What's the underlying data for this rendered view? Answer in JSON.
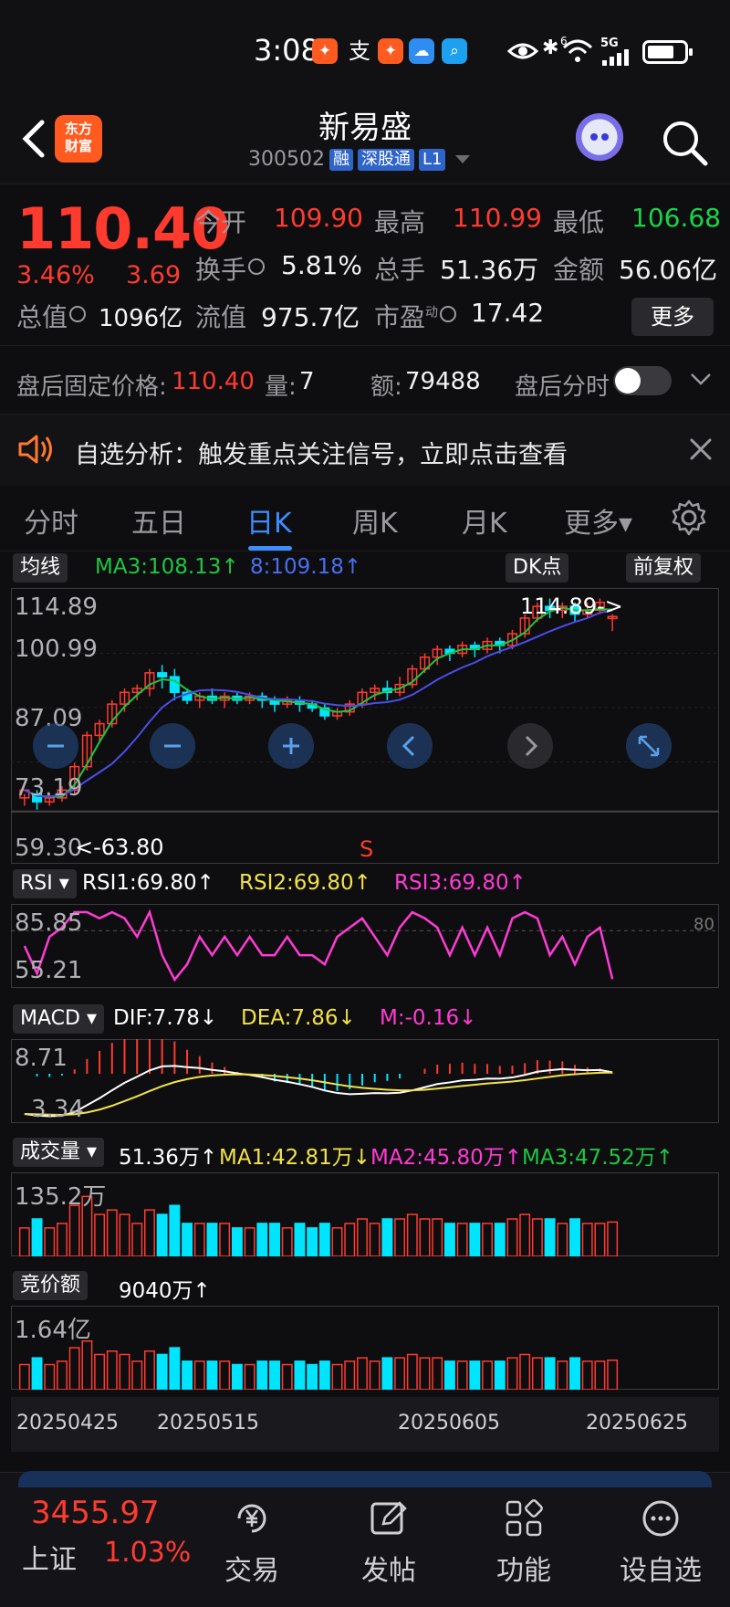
{
  "status_bar": {
    "time": "3:08",
    "apps": [
      "支"
    ],
    "network": "5G",
    "wifi_badge": "6"
  },
  "header": {
    "logo_text": "东方\n财富",
    "stock_name": "新易盛",
    "stock_code": "300502",
    "tags": [
      "融",
      "深股通",
      "L1"
    ]
  },
  "quote": {
    "price": "110.40",
    "change_pct": "3.46%",
    "change_amt": "3.69",
    "open_label": "今开",
    "open": "109.90",
    "high_label": "最高",
    "high": "110.99",
    "low_label": "最低",
    "low": "106.68",
    "turnover_label": "换手",
    "turnover": "5.81%",
    "volume_label": "总手",
    "volume": "51.36万",
    "amount_label": "金额",
    "amount": "56.06亿",
    "mktcap_label": "总值",
    "mktcap": "1096亿",
    "float_label": "流值",
    "float": "975.7亿",
    "pe_label": "市盈",
    "pe_super": "动",
    "pe": "17.42",
    "more_label": "更多"
  },
  "after_hours": {
    "price_label": "盘后固定价格:",
    "price": "110.40",
    "vol_label": "量:",
    "vol": "7",
    "amt_label": "额:",
    "amt": "79488",
    "timeshare_label": "盘后分时",
    "toggle_on": false
  },
  "notice": {
    "text": "自选分析：触发重点关注信号，立即点击查看"
  },
  "tabs": [
    {
      "label": "分时"
    },
    {
      "label": "五日"
    },
    {
      "label": "日K",
      "active": true
    },
    {
      "label": "周K"
    },
    {
      "label": "月K"
    },
    {
      "label": "更多▾"
    }
  ],
  "kline": {
    "ma_button": "均线",
    "ma3": "MA3:108.13↑",
    "ma8": "8:109.18↑",
    "dk_button": "DK点",
    "adjust_button": "前复权",
    "y_labels": [
      "114.89",
      "100.99",
      "87.09",
      "73.19",
      "59.30"
    ],
    "high_marker": "114.89->",
    "low_marker": "<-63.80",
    "s_mark": "S",
    "colors": {
      "up": "#ff3b30",
      "down": "#00e5ff",
      "ma3": "#1fc640",
      "ma8": "#4a4ee8"
    }
  },
  "rsi": {
    "button": "RSI",
    "rsi1": "RSI1:69.80↑",
    "rsi2": "RSI2:69.80↑",
    "rsi3": "RSI3:69.80↑",
    "y_labels": [
      "85.85",
      "55.21"
    ],
    "ref_line": "80"
  },
  "macd": {
    "button": "MACD",
    "dif": "DIF:7.78↓",
    "dea": "DEA:7.86↓",
    "m": "M:-0.16↓",
    "y_labels": [
      "8.71",
      "3.34"
    ]
  },
  "volume": {
    "button": "成交量",
    "value": "51.36万↑",
    "ma1": "MA1:42.81万↓",
    "ma2": "MA2:45.80万↑",
    "ma3": "MA3:47.52万↑",
    "y_label": "135.2万"
  },
  "auction": {
    "button": "竞价额",
    "value": "9040万↑",
    "y_label": "1.64亿"
  },
  "dates": [
    "20250425",
    "20250515",
    "20250605",
    "20250625"
  ],
  "chart_data": {
    "type": "candlestick",
    "y_axis_ticks": [
      59.3,
      73.19,
      87.09,
      100.99,
      114.89
    ],
    "period_high": 114.89,
    "period_low": 63.8,
    "last": {
      "open": 109.9,
      "high": 110.99,
      "low": 106.68,
      "close": 110.4
    },
    "candles": [
      [
        64,
        66,
        62,
        65
      ],
      [
        65,
        63,
        61,
        66
      ],
      [
        63,
        64,
        62,
        65
      ],
      [
        64,
        66,
        63,
        67
      ],
      [
        66,
        72,
        65,
        73
      ],
      [
        72,
        80,
        71,
        81
      ],
      [
        80,
        83,
        78,
        84
      ],
      [
        83,
        88,
        82,
        89
      ],
      [
        88,
        91,
        86,
        92
      ],
      [
        91,
        92,
        89,
        93
      ],
      [
        92,
        96,
        90,
        97
      ],
      [
        96,
        95,
        92,
        98
      ],
      [
        95,
        91,
        89,
        97
      ],
      [
        91,
        89,
        88,
        92
      ],
      [
        89,
        90,
        87,
        91
      ],
      [
        90,
        89,
        88,
        92
      ],
      [
        89,
        90,
        87,
        91
      ],
      [
        90,
        89,
        88,
        91
      ],
      [
        89,
        90,
        88,
        91
      ],
      [
        90,
        89,
        87,
        91
      ],
      [
        89,
        88,
        86,
        90
      ],
      [
        88,
        89,
        87,
        90
      ],
      [
        89,
        88,
        86,
        90
      ],
      [
        88,
        87,
        86,
        89
      ],
      [
        87,
        85,
        84,
        88
      ],
      [
        85,
        86,
        84,
        87
      ],
      [
        86,
        88,
        85,
        89
      ],
      [
        88,
        91,
        87,
        92
      ],
      [
        91,
        92,
        89,
        93
      ],
      [
        92,
        91,
        89,
        94
      ],
      [
        91,
        93,
        90,
        95
      ],
      [
        93,
        97,
        92,
        98
      ],
      [
        97,
        100,
        96,
        101
      ],
      [
        100,
        102,
        98,
        103
      ],
      [
        102,
        101,
        99,
        103
      ],
      [
        101,
        103,
        100,
        104
      ],
      [
        103,
        102,
        100,
        104
      ],
      [
        102,
        104,
        101,
        105
      ],
      [
        104,
        103,
        101,
        105
      ],
      [
        103,
        106,
        102,
        107
      ],
      [
        106,
        110,
        105,
        111
      ],
      [
        110,
        113,
        109,
        114
      ],
      [
        113,
        112,
        110,
        115
      ],
      [
        112,
        113,
        110,
        114
      ],
      [
        113,
        111,
        109,
        114
      ],
      [
        111,
        112,
        110,
        114
      ],
      [
        112,
        114,
        111,
        115
      ],
      [
        109.9,
        110.4,
        106.68,
        110.99
      ]
    ],
    "ma3_last": 108.13,
    "ma8_last": 109.18,
    "rsi": {
      "rsi1": 69.8,
      "rsi2": 69.8,
      "rsi3": 69.8,
      "ticks": [
        55.21,
        85.85
      ],
      "ref": 80
    },
    "macd": {
      "dif": 7.78,
      "dea": 7.86,
      "m": -0.16,
      "ticks": [
        3.34,
        8.71
      ]
    },
    "volume": {
      "last": "51.36万",
      "ma1": "42.81万",
      "ma2": "45.80万",
      "ma3": "47.52万",
      "tick": "135.2万"
    },
    "auction": {
      "last": "9040万",
      "tick": "1.64亿"
    },
    "x_tick_labels": [
      "20250425",
      "20250515",
      "20250605",
      "20250625"
    ]
  },
  "bottom_nav": {
    "index_value": "3455.97",
    "index_name": "上证",
    "index_change": "1.03%",
    "items": [
      {
        "label": "交易",
        "icon": "yen-icon"
      },
      {
        "label": "发帖",
        "icon": "edit-icon"
      },
      {
        "label": "功能",
        "icon": "grid-icon"
      },
      {
        "label": "设自选",
        "icon": "add-watch-icon"
      }
    ]
  }
}
